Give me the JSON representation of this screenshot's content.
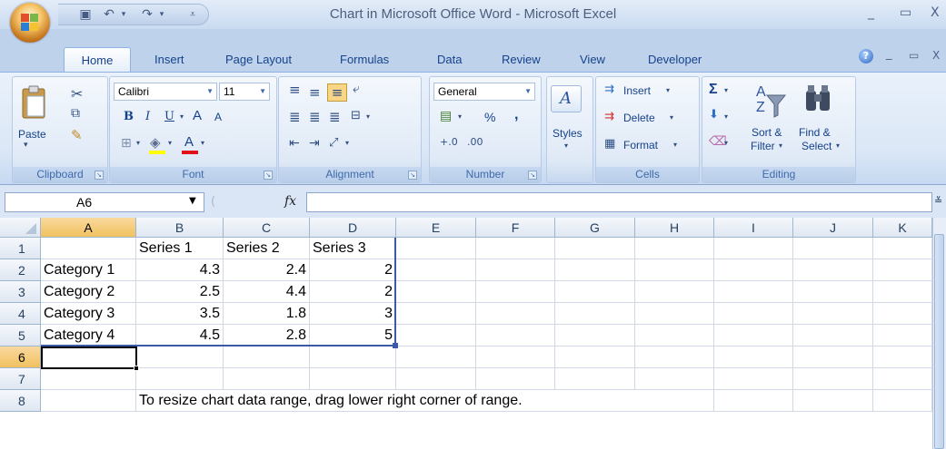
{
  "window": {
    "title": "Chart in Microsoft Office Word - Microsoft Excel",
    "min_glyph": "_",
    "restore_glyph": "▭",
    "close_glyph": "X"
  },
  "tabs": [
    {
      "label": "Home",
      "active": true
    },
    {
      "label": "Insert"
    },
    {
      "label": "Page Layout"
    },
    {
      "label": "Formulas"
    },
    {
      "label": "Data"
    },
    {
      "label": "Review"
    },
    {
      "label": "View"
    },
    {
      "label": "Developer"
    }
  ],
  "help_glyph": "?",
  "ribbon": {
    "clipboard": {
      "label": "Clipboard",
      "paste": "Paste"
    },
    "font": {
      "label": "Font",
      "name": "Calibri",
      "size": "11",
      "bold": "B",
      "italic": "I",
      "underline": "U",
      "grow": "A",
      "shrink": "A",
      "color": "A"
    },
    "alignment": {
      "label": "Alignment"
    },
    "number": {
      "label": "Number",
      "format": "General",
      "percent": "%",
      "comma": ","
    },
    "styles": {
      "label": "Styles"
    },
    "cells": {
      "label": "Cells",
      "insert": "Insert",
      "delete": "Delete",
      "format": "Format"
    },
    "editing": {
      "label": "Editing",
      "sigma": "Σ",
      "sort": "Sort &",
      "filter": "Filter",
      "find": "Find &",
      "select": "Select"
    }
  },
  "formula_bar": {
    "name_box": "A6",
    "fx": "fx",
    "value": ""
  },
  "sheet": {
    "columns": [
      "A",
      "B",
      "C",
      "D",
      "E",
      "F",
      "G",
      "H",
      "I",
      "J",
      "K"
    ],
    "rows": [
      "1",
      "2",
      "3",
      "4",
      "5",
      "6",
      "7",
      "8"
    ],
    "selected_row": "6",
    "header_row": [
      "",
      "Series 1",
      "Series 2",
      "Series 3"
    ],
    "data": [
      [
        "Category 1",
        "4.3",
        "2.4",
        "2"
      ],
      [
        "Category 2",
        "2.5",
        "4.4",
        "2"
      ],
      [
        "Category 3",
        "3.5",
        "1.8",
        "3"
      ],
      [
        "Category 4",
        "4.5",
        "2.8",
        "5"
      ]
    ],
    "note": "To resize chart data range, drag lower right corner of range."
  }
}
